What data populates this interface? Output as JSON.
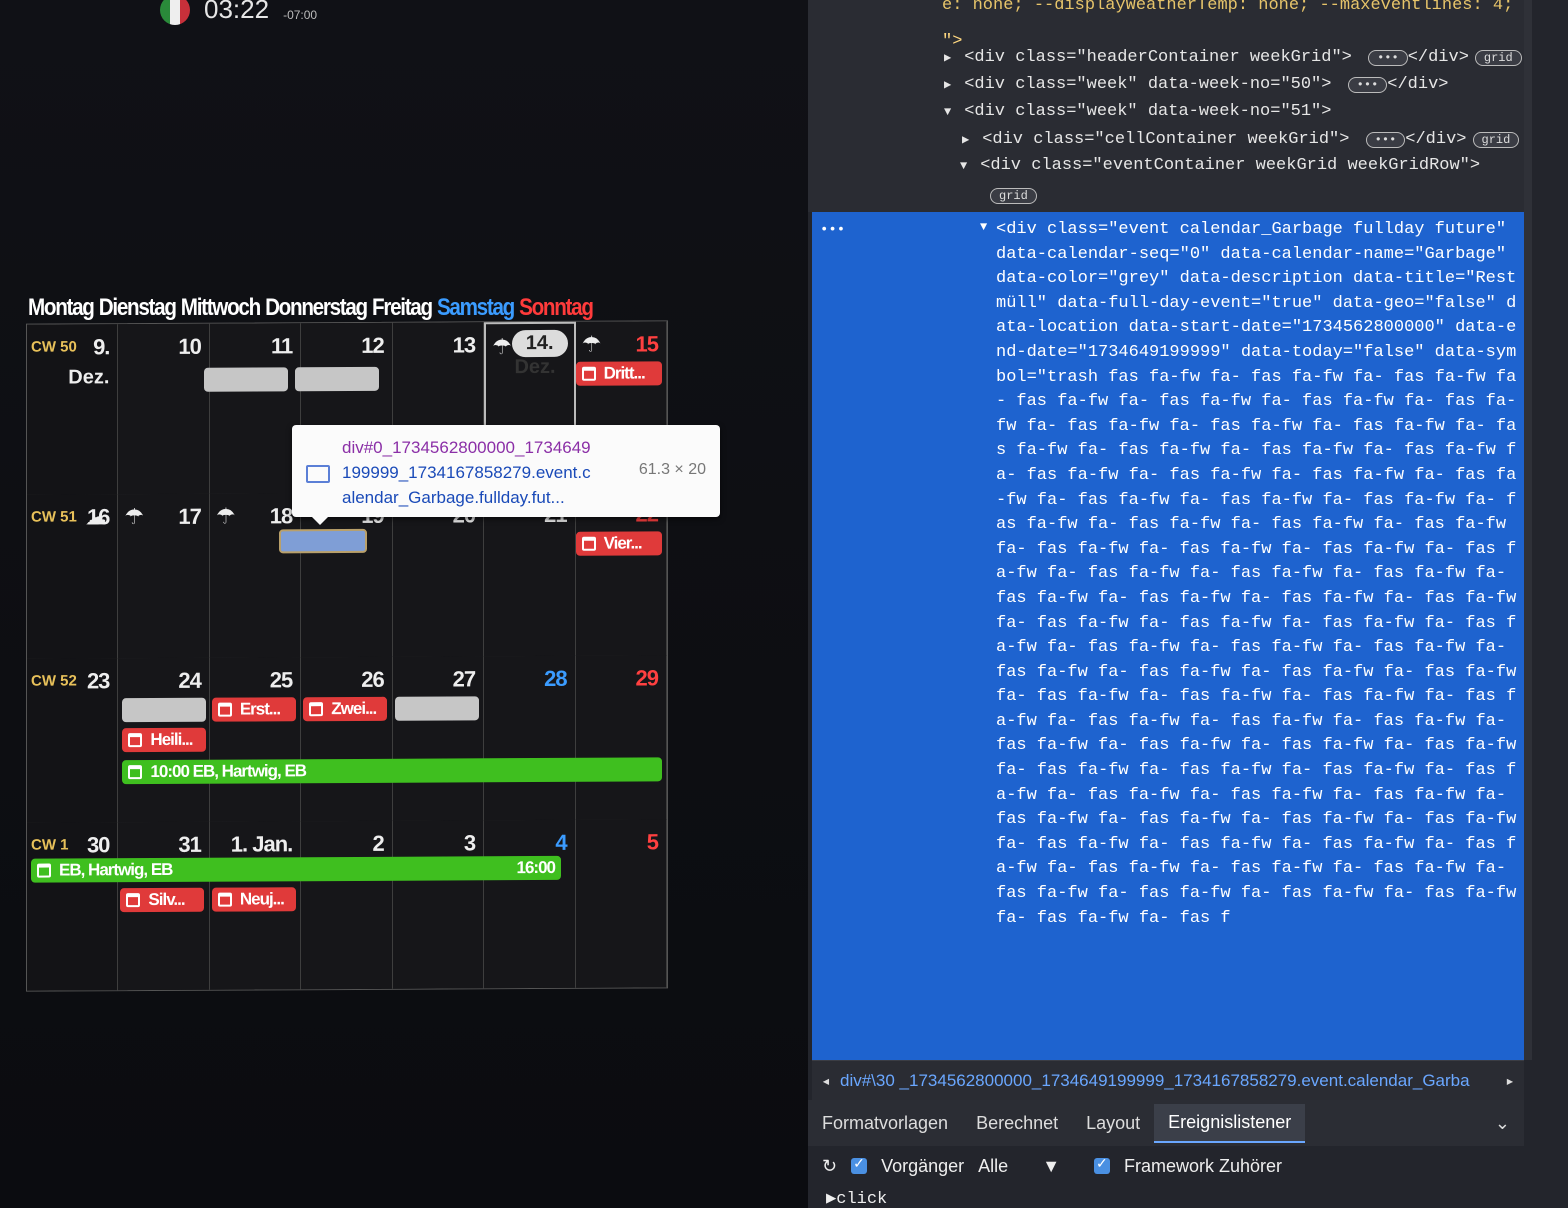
{
  "clock": {
    "time": "03:22",
    "tz": "-07:00"
  },
  "weekdays": [
    "Montag",
    "Dienstag",
    "Mittwoch",
    "Donnerstag",
    "Freitag",
    "Samstag",
    "Sonntag"
  ],
  "weeks": [
    {
      "cw": "CW 50",
      "days": [
        "9.",
        "10",
        "11",
        "12",
        "13",
        "14.",
        "15"
      ],
      "sub": "Dez.",
      "today_sub": "Dez."
    },
    {
      "cw": "CW 51",
      "days": [
        "16",
        "17",
        "18",
        "19",
        "20",
        "21",
        "22"
      ]
    },
    {
      "cw": "CW 52",
      "days": [
        "23",
        "24",
        "25",
        "26",
        "27",
        "28",
        "29"
      ]
    },
    {
      "cw": "CW 1",
      "days": [
        "30",
        "31",
        "1. Jan.",
        "2",
        "3",
        "4",
        "5"
      ]
    }
  ],
  "events": {
    "w50_sun": "Dritt...",
    "w51_sun": "Vier...",
    "w52_tue": "Erst...",
    "w52_wed": "Zwei...",
    "w52_mon": "Heili...",
    "w52_green": "10:00  EB, Hartwig, EB",
    "w1_green": "EB, Hartwig, EB",
    "w1_green_time": "16:00",
    "w1_tue": "Silv...",
    "w1_wed": "Neuj..."
  },
  "tooltip": {
    "line1": "div#0_1734562800000_1734649",
    "line2": "199999_1734167858279.event.c",
    "line3": "alendar_Garbage.fullday.fut...",
    "dims": "61.3 × 20"
  },
  "devtools": {
    "line0": "e: none; --displayWeatherTemp: none; --maxeventlines: 4;",
    "line1": "\">",
    "line2": "<div class=\"headerContainer weekGrid\">",
    "line3": "<div class=\"week\" data-week-no=\"50\">",
    "line4": "<div class=\"week\" data-week-no=\"51\">",
    "line5": "<div class=\"cellContainer weekGrid\">",
    "line6": "<div class=\"eventContainer weekGrid weekGridRow\">",
    "badge": "grid",
    "close_div": "</div>",
    "selected": "<div class=\"event calendar_Garbage fullday future\" data-calendar-seq=\"0\" data-calendar-name=\"Garbage\" data-color=\"grey\" data-description data-title=\"Restmüll\" data-full-day-event=\"true\" data-geo=\"false\" data-location data-start-date=\"1734562800000\" data-end-date=\"1734649199999\" data-today=\"false\" data-symbol=\"trash fas fa-fw fa- fas fa-fw fa- fas fa-fw fa- fas fa-fw fa- fas fa-fw fa- fas fa-fw fa- fas fa-fw fa- fas fa-fw fa- fas fa-fw fa- fas fa-fw fa- fas fa-fw fa- fas fa-fw fa- fas fa-fw fa- fas fa-fw fa- fas fa-fw fa- fas fa-fw fa- fas fa-fw fa- fas fa-fw fa- fas fa-fw fa- fas fa-fw fa- fas fa-fw fa- fas fa-fw fa- fas fa-fw fa- fas fa-fw fa- fas fa-fw fa- fas fa-fw fa- fas fa-fw fa- fas fa-fw fa- fas fa-fw fa- fas fa-fw fa- fas fa-fw fa- fas fa-fw fa- fas fa-fw fa- fas fa-fw fa- fas fa-fw fa- fas fa-fw fa- fas fa-fw fa- fas fa-fw fa- fas fa-fw fa- fas fa-fw fa- fas fa-fw fa- fas fa-fw fa- fas fa-fw fa- fas fa-fw fa- fas fa-fw fa- fas fa-fw fa- fas fa-fw fa- fas fa-fw fa- fas fa-fw fa- fas fa-fw fa- fas fa-fw fa- fas fa-fw fa- fas fa-fw fa- fas fa-fw fa- fas fa-fw fa- fas fa-fw fa- fas fa-fw fa- fas fa-fw fa- fas fa-fw fa- fas fa-fw fa- fas fa-fw fa- fas fa-fw fa- fas fa-fw fa- fas fa-fw fa- fas fa-fw fa- fas fa-fw fa- fas fa-fw fa- fas fa-fw fa- fas fa-fw fa- fas fa-fw fa- fas fa-fw fa- fas fa-fw fa- fas fa-fw fa- fas fa-fw fa- fas fa-fw fa- fas fa-fw fa- fas fa-fw fa- fas fa-fw fa- fas fa-fw fa- fas fa-fw fa- fas fa-fw fa- fas f",
    "breadcrumb": "div#\\30 _1734562800000_1734649199999_1734167858279.event.calendar_Garba",
    "tabs": [
      "Formatvorlagen",
      "Berechnet",
      "Layout",
      "Ereignislistener"
    ],
    "filter": {
      "ancestors": "Vorgänger",
      "all": "Alle",
      "framework": "Framework Zuhörer"
    },
    "event_item": "click"
  },
  "colors": {
    "saturday": "#3b9cff",
    "sunday": "#ff3b3b",
    "selection": "#1e63cf",
    "event_red": "#e03a3a",
    "event_green": "#3fbf1f",
    "event_grey": "#c6c6c6"
  }
}
